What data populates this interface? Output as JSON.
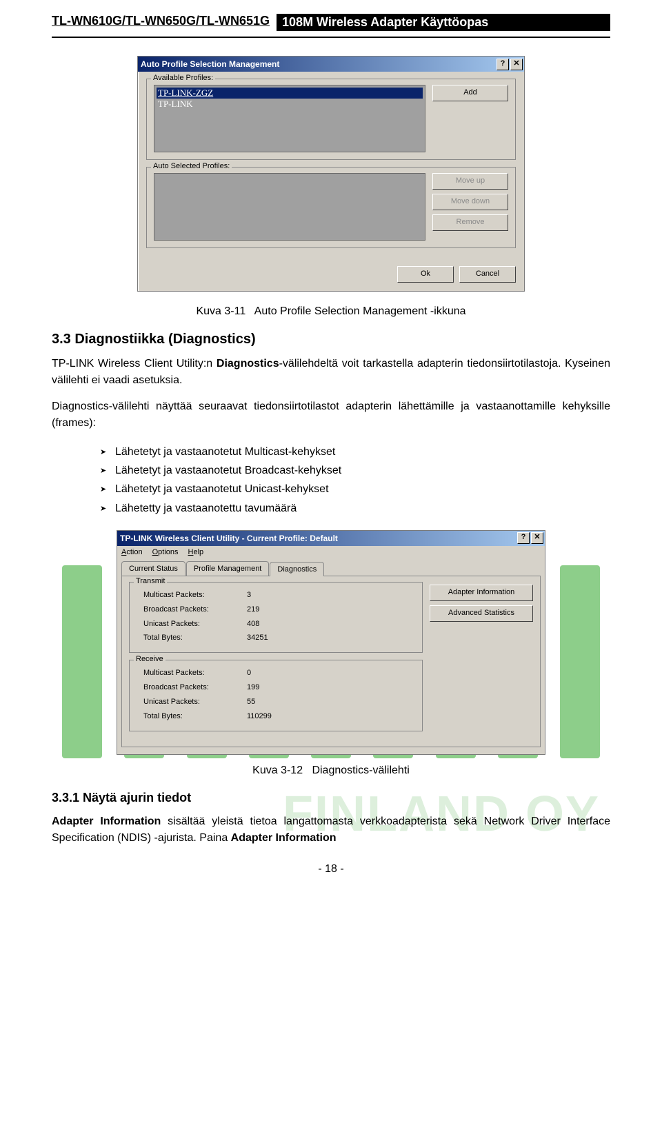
{
  "header": {
    "model": "TL-WN610G/TL-WN650G/TL-WN651G",
    "title": "108M Wireless Adapter Käyttöopas"
  },
  "dialog1": {
    "title": "Auto Profile Selection Management",
    "help_btn": "?",
    "close_btn": "✕",
    "group_available": "Available Profiles:",
    "group_selected": "Auto Selected Profiles:",
    "profiles": {
      "p0": "TP-LINK-ZGZ",
      "p1": "TP-LINK"
    },
    "btn_add": "Add",
    "btn_moveup": "Move up",
    "btn_movedown": "Move down",
    "btn_remove": "Remove",
    "btn_ok": "Ok",
    "btn_cancel": "Cancel"
  },
  "caption1": {
    "id": "Kuva 3-11",
    "text": "Auto Profile Selection Management -ikkuna"
  },
  "section": {
    "heading": "3.3 Diagnostiikka (Diagnostics)",
    "p1_a": "TP-LINK Wireless Client Utility:n ",
    "p1_b": "Diagnostics",
    "p1_c": "-välilehdeltä voit tarkastella adapterin tiedonsiirtotilastoja. Kyseinen välilehti ei vaadi asetuksia.",
    "p2": "Diagnostics-välilehti näyttää seuraavat tiedonsiirtotilastot adapterin lähettämille ja vastaanottamille kehyksille (frames):",
    "bullets": {
      "b0": "Lähetetyt ja vastaanotetut Multicast-kehykset",
      "b1": "Lähetetyt ja vastaanotetut Broadcast-kehykset",
      "b2": "Lähetetyt ja vastaanotetut Unicast-kehykset",
      "b3": "Lähetetty ja vastaanotettu tavumäärä"
    }
  },
  "dialog2": {
    "title": "TP-LINK Wireless Client Utility - Current Profile: Default",
    "help_btn": "?",
    "close_btn": "✕",
    "menu": {
      "m0": "Action",
      "m1": "Options",
      "m2": "Help"
    },
    "tabs": {
      "t0": "Current Status",
      "t1": "Profile Management",
      "t2": "Diagnostics"
    },
    "group_tx": "Transmit",
    "group_rx": "Receive",
    "tx": {
      "multicast_l": "Multicast Packets:",
      "multicast_v": "3",
      "broadcast_l": "Broadcast Packets:",
      "broadcast_v": "219",
      "unicast_l": "Unicast Packets:",
      "unicast_v": "408",
      "total_l": "Total Bytes:",
      "total_v": "34251"
    },
    "rx": {
      "multicast_l": "Multicast Packets:",
      "multicast_v": "0",
      "broadcast_l": "Broadcast Packets:",
      "broadcast_v": "199",
      "unicast_l": "Unicast Packets:",
      "unicast_v": "55",
      "total_l": "Total Bytes:",
      "total_v": "110299"
    },
    "btn_adapter": "Adapter Information",
    "btn_advanced": "Advanced Statistics"
  },
  "caption2": {
    "id": "Kuva 3-12",
    "text": "Diagnostics-välilehti"
  },
  "subsection": {
    "heading": "3.3.1 Näytä ajurin tiedot",
    "p_a": "Adapter Information",
    "p_b": " sisältää yleistä tietoa langattomasta verkkoadapterista sekä Network Driver Interface Specification (NDIS) -ajurista. Paina ",
    "p_c": "Adapter Information"
  },
  "pagenum": "- 18 -"
}
